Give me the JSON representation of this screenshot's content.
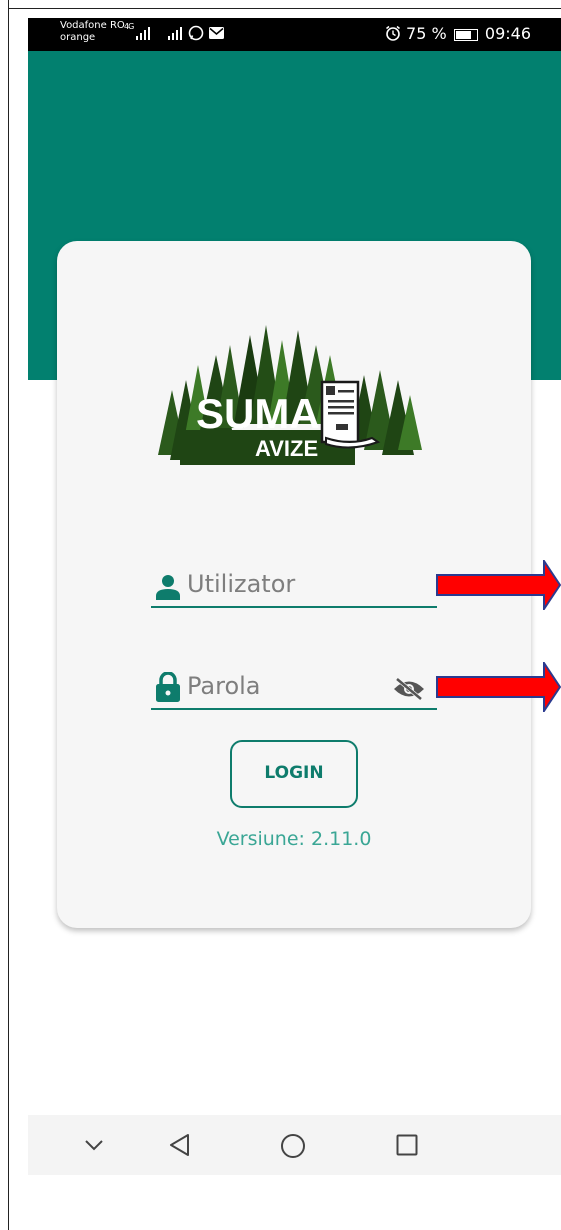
{
  "status_bar": {
    "carrier_line1": "Vodafone RO",
    "carrier_line2": "orange",
    "network": "4G",
    "battery": "75 %",
    "time": "09:46"
  },
  "login_card": {
    "logo_title": "SUMAL",
    "logo_subtitle": "AVIZE",
    "username_placeholder": "Utilizator",
    "password_placeholder": "Parola",
    "login_label": "LOGIN",
    "version_text": "Versiune: 2.11.0"
  },
  "colors": {
    "teal": "#02806f",
    "accent": "#0e7c6c",
    "version_text": "#3aa695",
    "annotation_arrow": "#ff0000"
  },
  "icons": [
    "person-icon",
    "lock-icon",
    "eye-off-icon",
    "alarm-icon",
    "whatsapp-icon",
    "mail-icon",
    "battery-icon"
  ],
  "navigation_bar": {
    "buttons": [
      "chevron-down-icon",
      "back-icon",
      "home-icon",
      "recents-icon"
    ]
  }
}
